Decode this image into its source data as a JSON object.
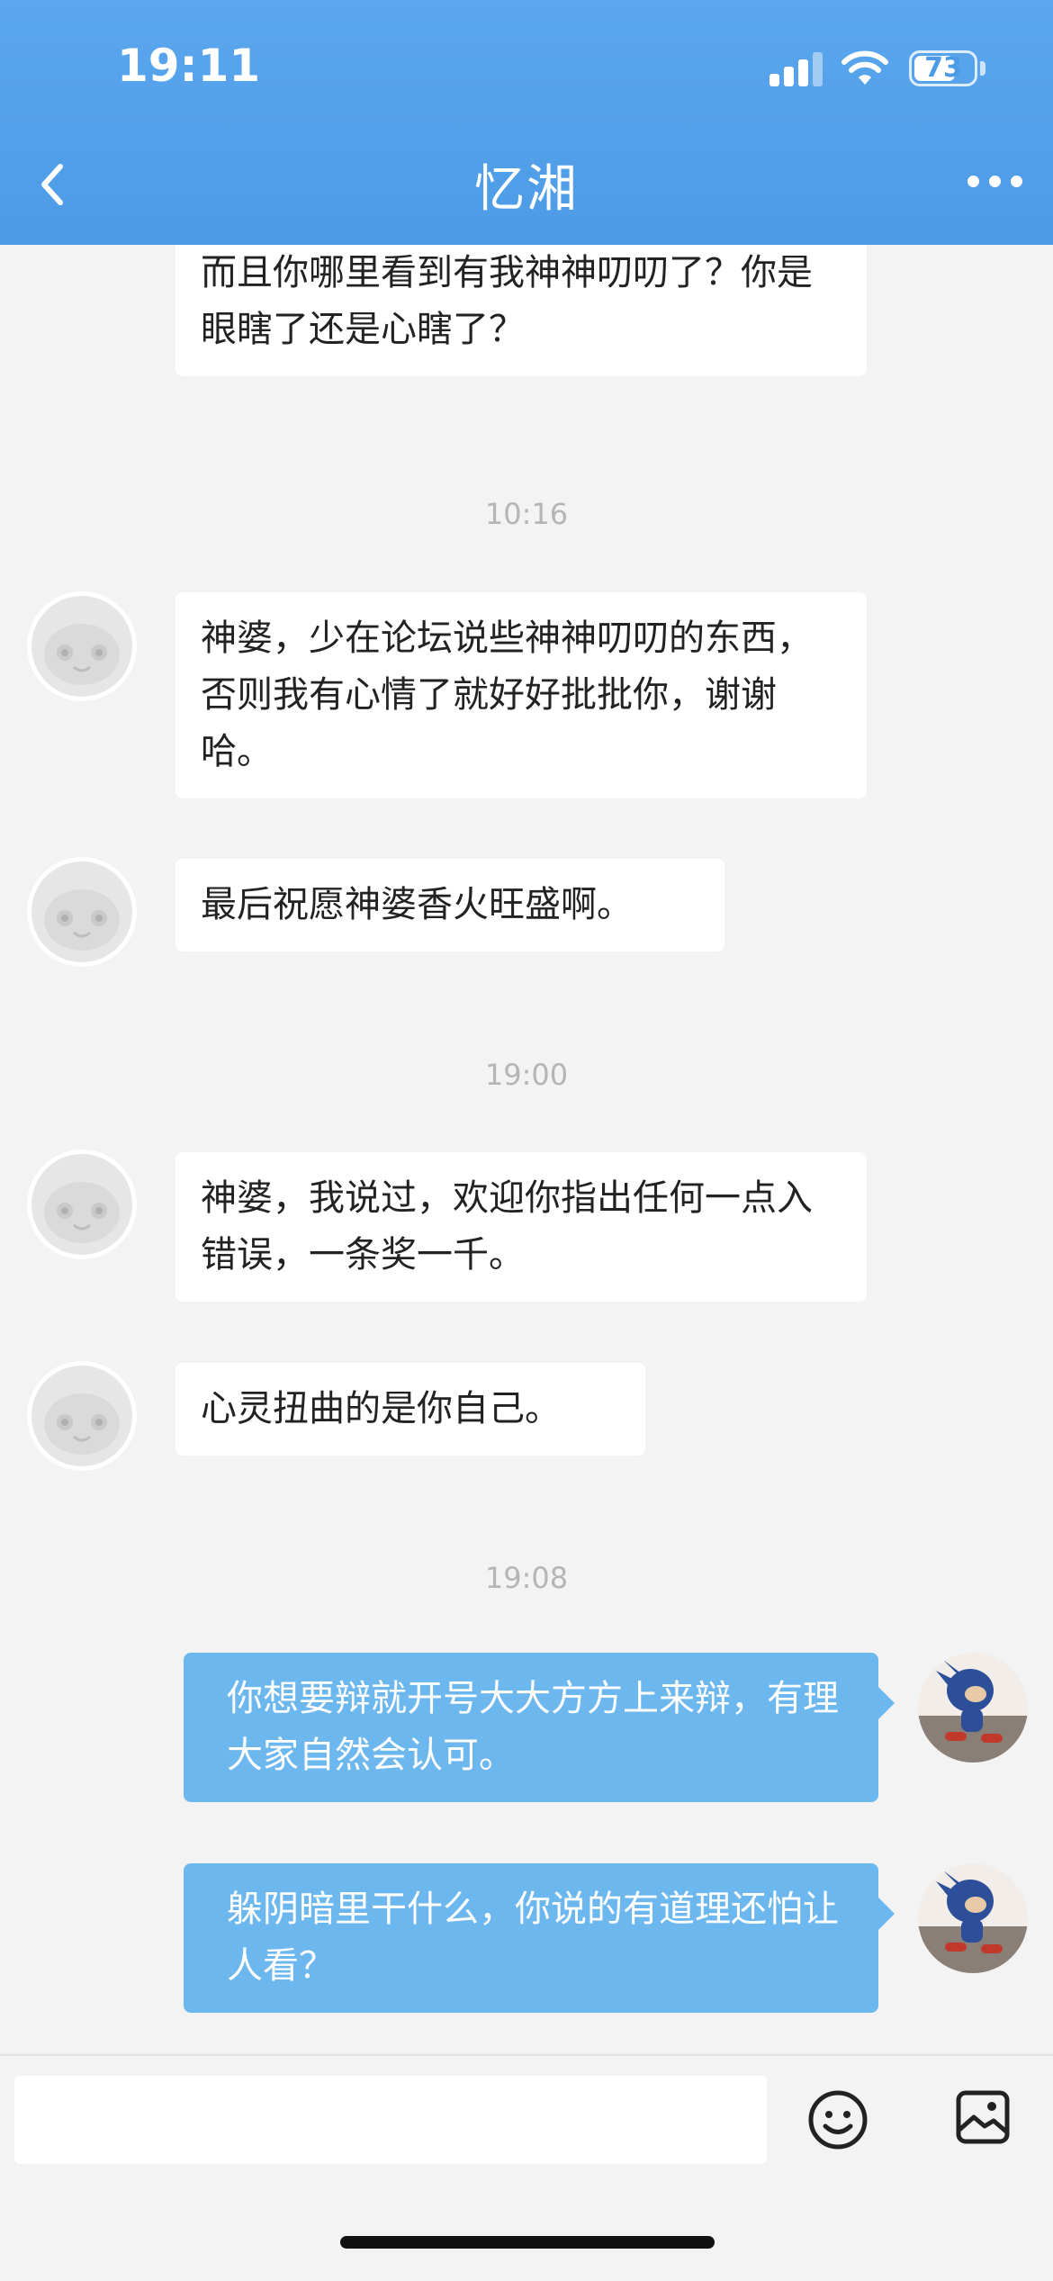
{
  "status_bar": {
    "time": "19:11",
    "battery": "73",
    "battery_level": 0.73
  },
  "header": {
    "title": "忆湘"
  },
  "messages": [
    {
      "dir": "in",
      "text": "完时要误机，也好意思大谈自己有道。而且你哪里看到有我神神叨叨了？你是眼瞎了还是心瞎了？"
    },
    {
      "type": "time",
      "text": "10:16"
    },
    {
      "dir": "in",
      "text": "神婆，少在论坛说些神神叨叨的东西，否则我有心情了就好好批批你，谢谢哈。"
    },
    {
      "dir": "in",
      "text": "最后祝愿神婆香火旺盛啊。"
    },
    {
      "type": "time",
      "text": "19:00"
    },
    {
      "dir": "in",
      "text": "神婆，我说过，欢迎你指出任何一点入错误，一条奖一千。"
    },
    {
      "dir": "in",
      "text": "心灵扭曲的是你自己。"
    },
    {
      "type": "time",
      "text": "19:08"
    },
    {
      "dir": "out",
      "text": "你想要辩就开号大大方方上来辩，有理大家自然会认可。"
    },
    {
      "dir": "out",
      "text": "躲阴暗里干什么，你说的有道理还怕让人看？"
    }
  ],
  "icons": [
    "back-arrow-icon",
    "more-dots-icon",
    "emoji-icon",
    "image-icon",
    "default-avatar-icon",
    "user-avatar-icon"
  ]
}
